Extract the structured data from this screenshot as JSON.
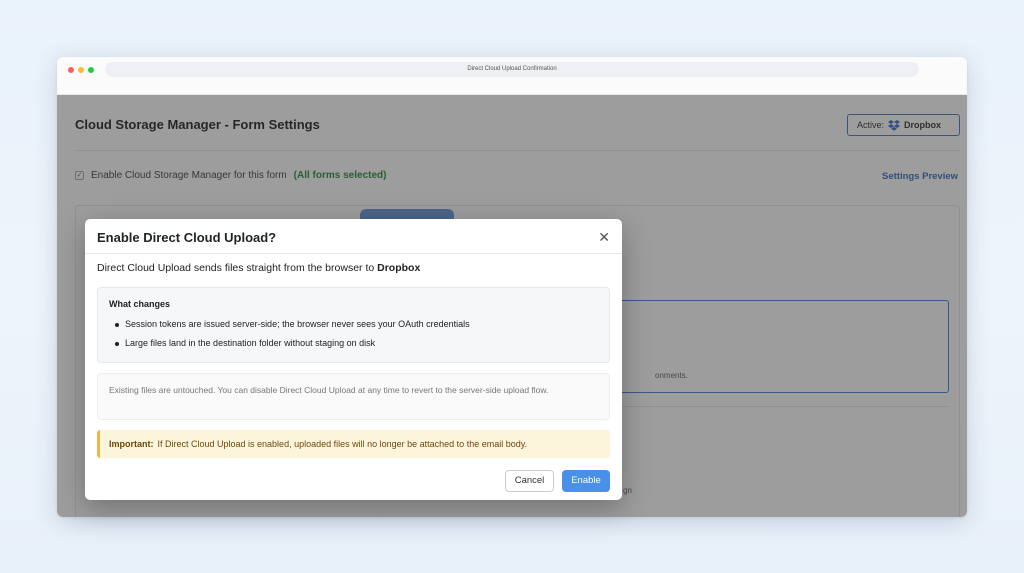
{
  "window": {
    "url_title": "Direct Cloud Upload Confirmation"
  },
  "page": {
    "title": "Cloud Storage Manager - Form Settings",
    "active_label": "Active:",
    "active_provider": "Dropbox",
    "enable_label": "Enable Cloud Storage Manager for this form",
    "enable_status": "(All forms selected)",
    "settings_preview": "Settings Preview",
    "background_fragment_1": "onments.",
    "background_fragment_2": "gn"
  },
  "modal": {
    "title": "Enable Direct Cloud Upload?",
    "intro_text": "Direct Cloud Upload sends files straight from the browser to",
    "intro_provider": "Dropbox",
    "changes_title": "What changes",
    "changes": [
      "Session tokens are issued server-side; the browser never sees your OAuth credentials",
      "Large files land in the destination folder without staging on disk"
    ],
    "note": "Existing files are untouched. You can disable Direct Cloud Upload at any time to revert to the server-side upload flow.",
    "warning_label": "Important:",
    "warning_text": "If Direct Cloud Upload is enabled, uploaded files will no longer be attached to the email body.",
    "cancel_label": "Cancel",
    "enable_label": "Enable"
  },
  "colors": {
    "accent": "#4a90e8",
    "warning_bg": "#fdf4dc",
    "warning_border": "#e9b949",
    "success_text": "#1a7f2b",
    "link": "#2a63b5"
  }
}
